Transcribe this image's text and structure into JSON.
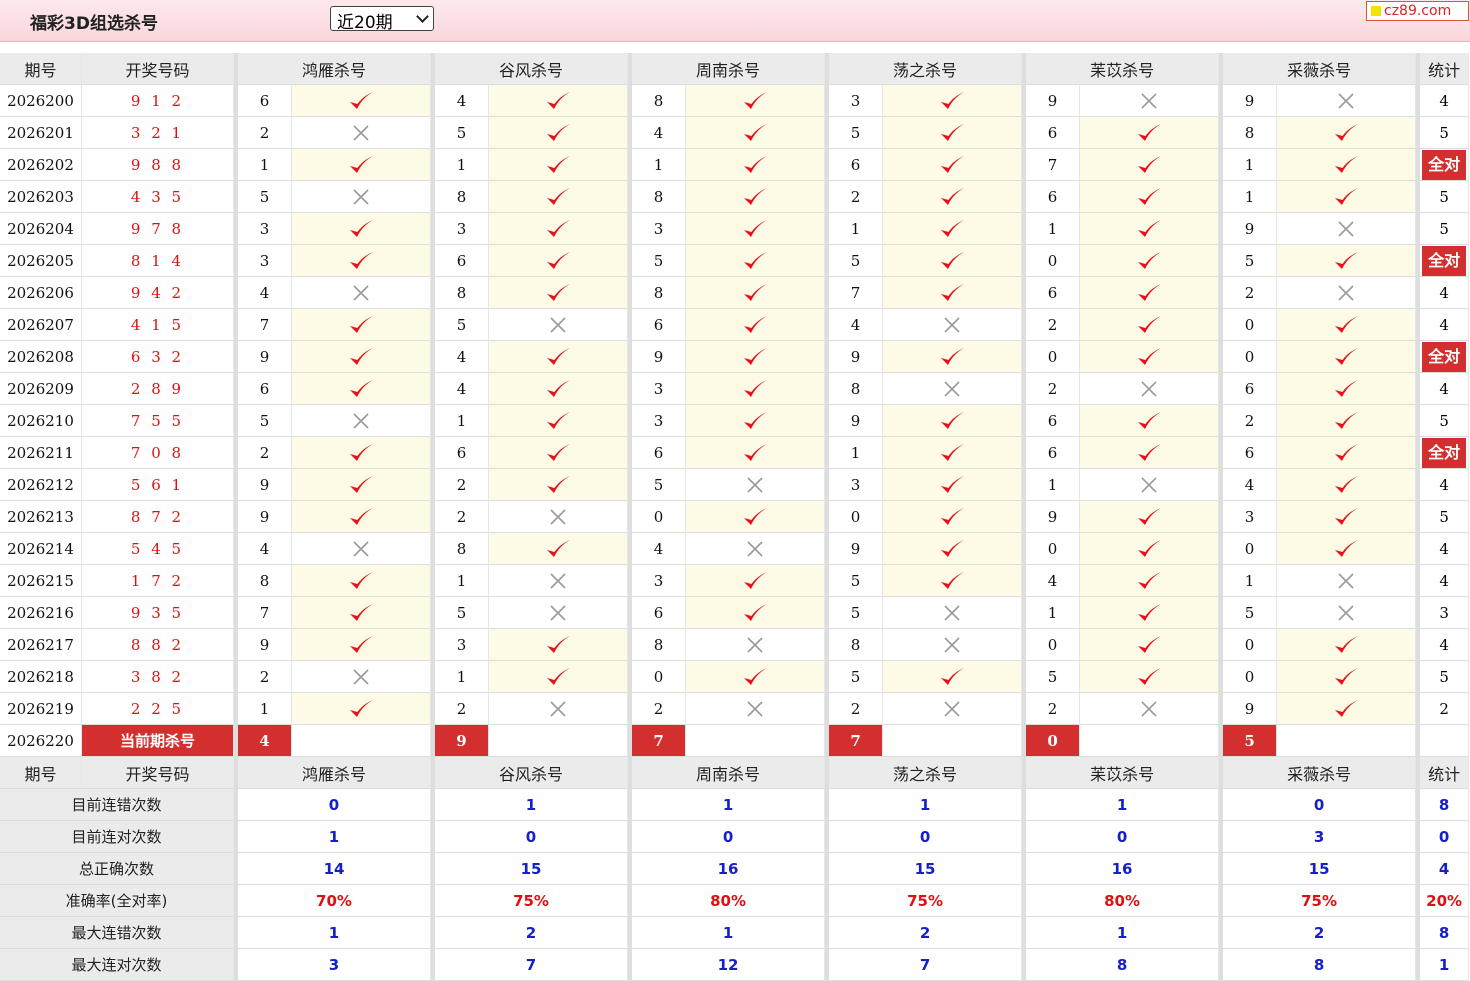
{
  "header": {
    "title": "福彩3D组选杀号",
    "period_select": "近20期",
    "logo": "cz89.com"
  },
  "columns": {
    "issue": "期号",
    "draw": "开奖号码",
    "experts": [
      "鸿雁杀号",
      "谷风杀号",
      "周南杀号",
      "荡之杀号",
      "苿苡杀号",
      "采薇杀号"
    ],
    "stat": "统计"
  },
  "all_correct_label": "全对",
  "rows": [
    {
      "issue": "2026200",
      "draw": "9 1 2",
      "kill": [
        "6",
        "4",
        "8",
        "3",
        "9",
        "9"
      ],
      "ok": [
        1,
        1,
        1,
        1,
        0,
        0
      ],
      "stat": "4"
    },
    {
      "issue": "2026201",
      "draw": "3 2 1",
      "kill": [
        "2",
        "5",
        "4",
        "5",
        "6",
        "8"
      ],
      "ok": [
        0,
        1,
        1,
        1,
        1,
        1
      ],
      "stat": "5"
    },
    {
      "issue": "2026202",
      "draw": "9 8 8",
      "kill": [
        "1",
        "1",
        "1",
        "6",
        "7",
        "1"
      ],
      "ok": [
        1,
        1,
        1,
        1,
        1,
        1
      ],
      "stat": "全对"
    },
    {
      "issue": "2026203",
      "draw": "4 3 5",
      "kill": [
        "5",
        "8",
        "8",
        "2",
        "6",
        "1"
      ],
      "ok": [
        0,
        1,
        1,
        1,
        1,
        1
      ],
      "stat": "5"
    },
    {
      "issue": "2026204",
      "draw": "9 7 8",
      "kill": [
        "3",
        "3",
        "3",
        "1",
        "1",
        "9"
      ],
      "ok": [
        1,
        1,
        1,
        1,
        1,
        0
      ],
      "stat": "5"
    },
    {
      "issue": "2026205",
      "draw": "8 1 4",
      "kill": [
        "3",
        "6",
        "5",
        "5",
        "0",
        "5"
      ],
      "ok": [
        1,
        1,
        1,
        1,
        1,
        1
      ],
      "stat": "全对"
    },
    {
      "issue": "2026206",
      "draw": "9 4 2",
      "kill": [
        "4",
        "8",
        "8",
        "7",
        "6",
        "2"
      ],
      "ok": [
        0,
        1,
        1,
        1,
        1,
        0
      ],
      "stat": "4"
    },
    {
      "issue": "2026207",
      "draw": "4 1 5",
      "kill": [
        "7",
        "5",
        "6",
        "4",
        "2",
        "0"
      ],
      "ok": [
        1,
        0,
        1,
        0,
        1,
        1
      ],
      "stat": "4"
    },
    {
      "issue": "2026208",
      "draw": "6 3 2",
      "kill": [
        "9",
        "4",
        "9",
        "9",
        "0",
        "0"
      ],
      "ok": [
        1,
        1,
        1,
        1,
        1,
        1
      ],
      "stat": "全对"
    },
    {
      "issue": "2026209",
      "draw": "2 8 9",
      "kill": [
        "6",
        "4",
        "3",
        "8",
        "2",
        "6"
      ],
      "ok": [
        1,
        1,
        1,
        0,
        0,
        1
      ],
      "stat": "4"
    },
    {
      "issue": "2026210",
      "draw": "7 5 5",
      "kill": [
        "5",
        "1",
        "3",
        "9",
        "6",
        "2"
      ],
      "ok": [
        0,
        1,
        1,
        1,
        1,
        1
      ],
      "stat": "5"
    },
    {
      "issue": "2026211",
      "draw": "7 0 8",
      "kill": [
        "2",
        "6",
        "6",
        "1",
        "6",
        "6"
      ],
      "ok": [
        1,
        1,
        1,
        1,
        1,
        1
      ],
      "stat": "全对"
    },
    {
      "issue": "2026212",
      "draw": "5 6 1",
      "kill": [
        "9",
        "2",
        "5",
        "3",
        "1",
        "4"
      ],
      "ok": [
        1,
        1,
        0,
        1,
        0,
        1
      ],
      "stat": "4"
    },
    {
      "issue": "2026213",
      "draw": "8 7 2",
      "kill": [
        "9",
        "2",
        "0",
        "0",
        "9",
        "3"
      ],
      "ok": [
        1,
        0,
        1,
        1,
        1,
        1
      ],
      "stat": "5"
    },
    {
      "issue": "2026214",
      "draw": "5 4 5",
      "kill": [
        "4",
        "8",
        "4",
        "9",
        "0",
        "0"
      ],
      "ok": [
        0,
        1,
        0,
        1,
        1,
        1
      ],
      "stat": "4"
    },
    {
      "issue": "2026215",
      "draw": "1 7 2",
      "kill": [
        "8",
        "1",
        "3",
        "5",
        "4",
        "1"
      ],
      "ok": [
        1,
        0,
        1,
        1,
        1,
        0
      ],
      "stat": "4"
    },
    {
      "issue": "2026216",
      "draw": "9 3 5",
      "kill": [
        "7",
        "5",
        "6",
        "5",
        "1",
        "5"
      ],
      "ok": [
        1,
        0,
        1,
        0,
        1,
        0
      ],
      "stat": "3"
    },
    {
      "issue": "2026217",
      "draw": "8 8 2",
      "kill": [
        "9",
        "3",
        "8",
        "8",
        "0",
        "0"
      ],
      "ok": [
        1,
        1,
        0,
        0,
        1,
        1
      ],
      "stat": "4"
    },
    {
      "issue": "2026218",
      "draw": "3 8 2",
      "kill": [
        "2",
        "1",
        "0",
        "5",
        "5",
        "0"
      ],
      "ok": [
        0,
        1,
        1,
        1,
        1,
        1
      ],
      "stat": "5"
    },
    {
      "issue": "2026219",
      "draw": "2 2 5",
      "kill": [
        "1",
        "2",
        "2",
        "2",
        "2",
        "9"
      ],
      "ok": [
        1,
        0,
        0,
        0,
        0,
        1
      ],
      "stat": "2"
    }
  ],
  "current": {
    "issue": "2026220",
    "label": "当前期杀号",
    "kill": [
      "4",
      "9",
      "7",
      "7",
      "0",
      "5"
    ]
  },
  "stats": [
    {
      "label": "目前连错次数",
      "values": [
        "0",
        "1",
        "1",
        "1",
        "1",
        "0"
      ],
      "stat": "8",
      "color": "blue"
    },
    {
      "label": "目前连对次数",
      "values": [
        "1",
        "0",
        "0",
        "0",
        "0",
        "3"
      ],
      "stat": "0",
      "color": "blue"
    },
    {
      "label": "总正确次数",
      "values": [
        "14",
        "15",
        "16",
        "15",
        "16",
        "15"
      ],
      "stat": "4",
      "color": "blue"
    },
    {
      "label": "准确率(全对率)",
      "values": [
        "70%",
        "75%",
        "80%",
        "75%",
        "80%",
        "75%"
      ],
      "stat": "20%",
      "color": "red"
    },
    {
      "label": "最大连错次数",
      "values": [
        "1",
        "2",
        "1",
        "2",
        "1",
        "2"
      ],
      "stat": "8",
      "color": "blue"
    },
    {
      "label": "最大连对次数",
      "values": [
        "3",
        "7",
        "12",
        "7",
        "8",
        "8"
      ],
      "stat": "1",
      "color": "blue"
    }
  ],
  "colors": {
    "accent": "#d32f2f",
    "check": "#e8101a",
    "cross": "#9a9a9a",
    "blue": "#1520c8",
    "header_bg": "#fbe0e4"
  }
}
